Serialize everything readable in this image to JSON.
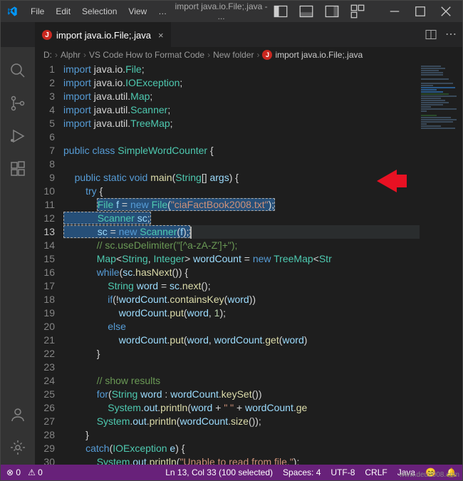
{
  "titlebar": {
    "menu": [
      "File",
      "Edit",
      "Selection",
      "View"
    ],
    "title": "import java.io.File;.java - ..."
  },
  "tab": {
    "name": "import java.io.File;.java"
  },
  "breadcrumb": [
    "D:",
    "Alphr",
    "VS Code How to Format Code",
    "New folder",
    "import java.io.File;.java"
  ],
  "lines": [
    1,
    2,
    3,
    4,
    5,
    6,
    7,
    8,
    9,
    10,
    11,
    12,
    13,
    14,
    15,
    16,
    17,
    18,
    19,
    20,
    21,
    22,
    23,
    24,
    25,
    26,
    27,
    28,
    29,
    30
  ],
  "activeLine": 13,
  "code": {
    "l1": {
      "a": "import",
      "b": " java.io.",
      "c": "File",
      "d": ";"
    },
    "l2": {
      "a": "import",
      "b": " java.io.",
      "c": "IOException",
      "d": ";"
    },
    "l3": {
      "a": "import",
      "b": " java.util.",
      "c": "Map",
      "d": ";"
    },
    "l4": {
      "a": "import",
      "b": " java.util.",
      "c": "Scanner",
      "d": ";"
    },
    "l5": {
      "a": "import",
      "b": " java.util.",
      "c": "TreeMap",
      "d": ";"
    },
    "l7": {
      "a": "public",
      "b": "class",
      "c": "SimpleWordCounter",
      "d": "{"
    },
    "l9": {
      "a": "public",
      "b": "static",
      "c": "void",
      "d": "main",
      "e": "String",
      "f": "args",
      "g": "{"
    },
    "l10": {
      "a": "try",
      "b": "{"
    },
    "l11": {
      "a": "File",
      "b": "f",
      "c": "new",
      "d": "File",
      "e": "\"ciaFactBook2008.txt\""
    },
    "l12": {
      "a": "Scanner",
      "b": "sc"
    },
    "l13": {
      "a": "sc",
      "b": "new",
      "c": "Scanner",
      "d": "f"
    },
    "l14": {
      "a": "// sc.useDelimiter(\"[^a-zA-Z']+\");"
    },
    "l15": {
      "a": "Map",
      "b": "String",
      "c": "Integer",
      "d": "wordCount",
      "e": "new",
      "f": "TreeMap",
      "g": "Str"
    },
    "l16": {
      "a": "while",
      "b": "sc",
      "c": "hasNext"
    },
    "l17": {
      "a": "String",
      "b": "word",
      "c": "sc",
      "d": "next"
    },
    "l18": {
      "a": "if",
      "b": "wordCount",
      "c": "containsKey",
      "d": "word"
    },
    "l19": {
      "a": "wordCount",
      "b": "put",
      "c": "word",
      "d": "1"
    },
    "l20": {
      "a": "else"
    },
    "l21": {
      "a": "wordCount",
      "b": "put",
      "c": "word",
      "d": "wordCount",
      "e": "get",
      "f": "word"
    },
    "l24": {
      "a": "// show results"
    },
    "l25": {
      "a": "for",
      "b": "String",
      "c": "word",
      "d": "wordCount",
      "e": "keySet"
    },
    "l26": {
      "a": "System",
      "b": "out",
      "c": "println",
      "d": "word",
      "e": "\" \"",
      "f": "wordCount",
      "g": "ge"
    },
    "l27": {
      "a": "System",
      "b": "out",
      "c": "println",
      "d": "wordCount",
      "e": "size"
    },
    "l29": {
      "a": "catch",
      "b": "IOException",
      "c": "e"
    },
    "l30": {
      "a": "System",
      "b": "out",
      "c": "println",
      "d": "\"Unable to read from file.\""
    }
  },
  "status": {
    "errors": "0",
    "warnings": "0",
    "pos": "Ln 13, Col 33 (100 selected)",
    "spaces": "Spaces: 4",
    "enc": "UTF-8",
    "eol": "CRLF",
    "lang": "Java",
    "bell": "🔔"
  },
  "watermark": "www.deu2008.com"
}
